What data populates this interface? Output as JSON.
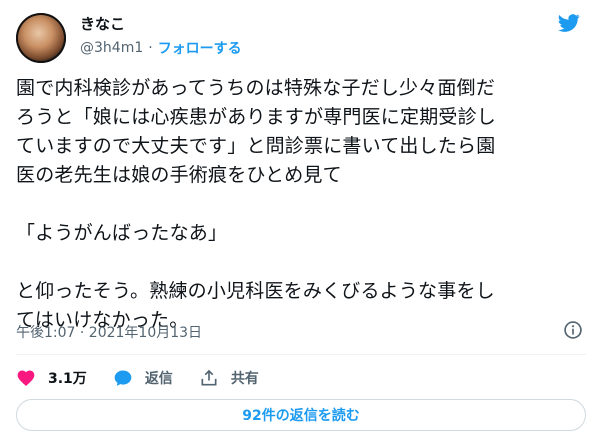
{
  "author": {
    "display_name": "きなこ",
    "handle": "@3h4m1",
    "separator": "·",
    "follow_label": "フォローする"
  },
  "tweet": {
    "text": "園で内科検診があってうちのは特殊な子だし少々面倒だ\nろうと「娘には心疾患がありますが専門医に定期受診し\nていますので大丈夫です」と問診票に書いて出したら園\n医の老先生は娘の手術痕をひとめ見て\n\n「ようがんばったなあ」\n\nと仰ったそう。熟練の小児科医をみくびるような事をし\nてはいけなかった。"
  },
  "meta": {
    "timestamp": "午後1:07 · 2021年10月13日"
  },
  "actions": {
    "likes_count": "3.1万",
    "reply_label": "返信",
    "share_label": "共有"
  },
  "replies_button_label": "92件の返信を読む",
  "colors": {
    "accent": "#1d9bf0",
    "like": "#f91880",
    "muted": "#536471"
  },
  "icons": [
    "twitter-bird-icon",
    "heart-icon",
    "reply-bubble-icon",
    "share-icon",
    "info-icon"
  ]
}
